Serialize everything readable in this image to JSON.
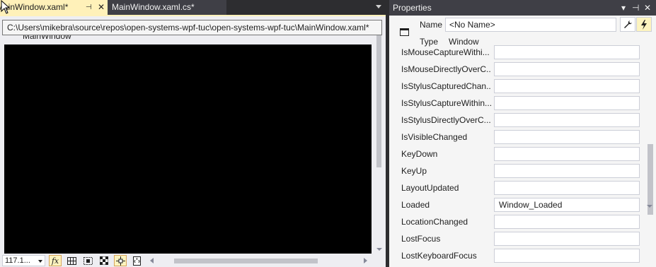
{
  "editor": {
    "tabs": [
      {
        "label": "MainWindow.xaml*",
        "active": true
      },
      {
        "label": "MainWindow.xaml.cs*",
        "active": false
      }
    ],
    "pin_glyph": "⊣",
    "close_glyph": "✕",
    "tooltip_path": "C:\\Users\\mikebra\\source\\repos\\open-systems-wpf-tuc\\open-systems-wpf-tuc\\MainWindow.xaml*",
    "window_caption": "MainWindow",
    "zoom": "117.1...",
    "fx_label": "fx",
    "colors": {
      "active_tab": "#fff1b9",
      "canvas": "#000000",
      "chrome": "#2d2d30"
    }
  },
  "properties": {
    "title": "Properties",
    "title_icons": [
      "dropdown-icon",
      "pin-icon",
      "close-icon"
    ],
    "name_label": "Name",
    "name_value": "<No Name>",
    "type_label": "Type",
    "type_value": "Window",
    "events": [
      {
        "name": "IsMouseCaptureWithi...",
        "value": ""
      },
      {
        "name": "IsMouseDirectlyOverC...",
        "value": ""
      },
      {
        "name": "IsStylusCapturedChan...",
        "value": ""
      },
      {
        "name": "IsStylusCaptureWithin...",
        "value": ""
      },
      {
        "name": "IsStylusDirectlyOverC...",
        "value": ""
      },
      {
        "name": "IsVisibleChanged",
        "value": ""
      },
      {
        "name": "KeyDown",
        "value": ""
      },
      {
        "name": "KeyUp",
        "value": ""
      },
      {
        "name": "LayoutUpdated",
        "value": ""
      },
      {
        "name": "Loaded",
        "value": "Window_Loaded"
      },
      {
        "name": "LocationChanged",
        "value": ""
      },
      {
        "name": "LostFocus",
        "value": ""
      },
      {
        "name": "LostKeyboardFocus",
        "value": ""
      }
    ]
  }
}
